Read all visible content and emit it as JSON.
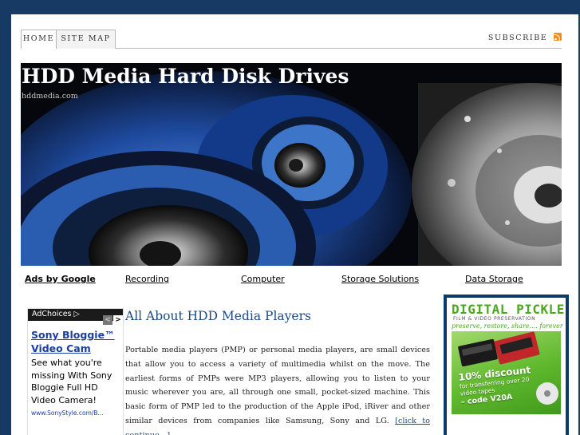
{
  "nav": {
    "tabs": [
      {
        "label": "HOME"
      },
      {
        "label": "SITE MAP"
      }
    ],
    "subscribe_label": "SUBSCRIBE"
  },
  "header": {
    "title": "HDD Media Hard Disk Drives",
    "url": "hddmedia.com"
  },
  "ad_links": {
    "heading": "Ads by Google",
    "items": [
      "Recording",
      "Computer",
      "Storage Solutions",
      "Data Storage"
    ]
  },
  "left_ad": {
    "adchoices_label": "AdChoices",
    "prev_arrow": "<",
    "next_arrow": ">",
    "title": "Sony Bloggie™ Video Cam",
    "body": "See what you're missing With Sony Bloggie Full HD Video Camera!",
    "url": "www.SonyStyle.com/B..."
  },
  "article": {
    "title": "All About HDD Media Players",
    "body": "Portable media players (PMP) or personal media players, are small devices that allow you to access a variety of multimedia whilst on the move. The earliest forms of PMPs were MP3 players, allowing you to listen to your music wherever you are, all through one small, pocket-sized machine. This basic form of PMP led to the production of the Apple iPod, iRiver and other similar devices from companies like Samsung, Sony and LG.",
    "continue_link": "[click to continue…]"
  },
  "side_ad": {
    "brand": "DIGITAL PICKLE",
    "subtitle": "FILM & VIDEO PRESERVATION",
    "tagline": "preserve, restore, share.... forever",
    "promo_headline": "10% discount",
    "promo_detail": "for transferring over 20 video tapes",
    "promo_code": "– code V20A"
  },
  "colors": {
    "page_background": "#163a63",
    "link_blue": "#1c4a86",
    "ad_title_blue": "#1a3fa0",
    "brand_green": "#4aa81c",
    "rss_orange": "#f78c1d"
  },
  "icons": {
    "rss": "rss-feed-icon",
    "adchoices": "adchoices-triangle-icon"
  }
}
